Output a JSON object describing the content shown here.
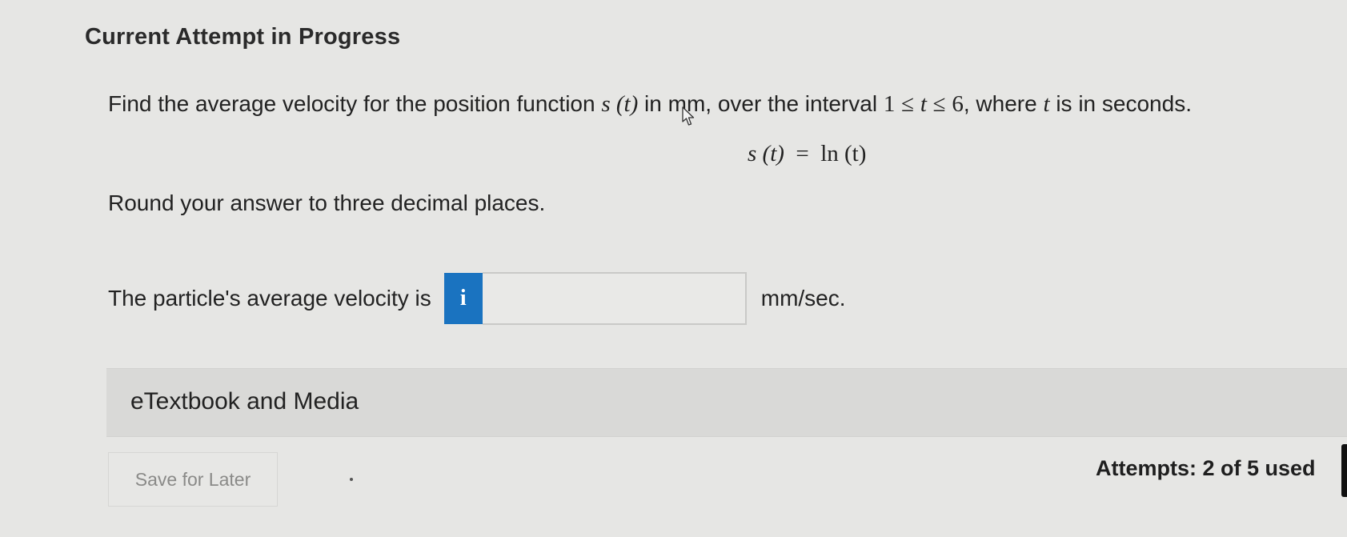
{
  "header": {
    "title": "Current Attempt in Progress"
  },
  "question": {
    "text_before": "Find the average velocity for the position function ",
    "function_expr": "s (t)",
    "text_middle": " in mm, over the interval ",
    "interval_left": "1",
    "interval_leq1": "≤",
    "interval_var": "t",
    "interval_leq2": "≤",
    "interval_right": "6",
    "text_where": ", where ",
    "where_var": "t",
    "text_end": " is in seconds."
  },
  "equation": {
    "lhs": "s (t)",
    "equals": "=",
    "rhs": "ln (t)"
  },
  "instruction": "Round your answer to three decimal places.",
  "answer": {
    "label": "The particle's average velocity is",
    "info_glyph": "i",
    "input_value": "",
    "unit": "mm/sec."
  },
  "etextbook": {
    "label": "eTextbook and Media"
  },
  "footer": {
    "save_label": "Save for Later",
    "attempts_label": "Attempts: 2 of 5 used"
  },
  "colors": {
    "info_button": "#1a73c0",
    "background": "#e6e6e4",
    "bar": "#d9d9d7"
  },
  "icons": {
    "info": "info-icon",
    "cursor": "mouse-pointer-icon"
  }
}
